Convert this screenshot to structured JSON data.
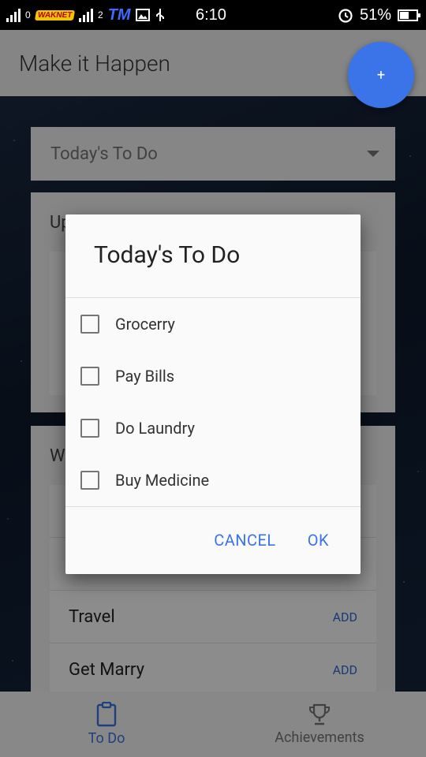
{
  "status_bar": {
    "carrier_logo": "WAKNET",
    "sim2_indicator": "2",
    "carrier_name": "TM",
    "time": "6:10",
    "battery": "51%",
    "icons": [
      "signal-icon",
      "image-icon",
      "usb-icon",
      "alarm-icon",
      "battery-icon"
    ]
  },
  "app_bar": {
    "title": "Make it Happen",
    "fab_label": "+"
  },
  "main": {
    "dropdown_value": "Today's To Do",
    "card2_title": "Up",
    "card3_title": "W",
    "goals": [
      {
        "name": "Travel",
        "action": "ADD"
      },
      {
        "name": "Get Marry",
        "action": "ADD"
      }
    ]
  },
  "bottom_nav": {
    "items": [
      {
        "label": "To Do",
        "icon": "clipboard-icon",
        "active": true
      },
      {
        "label": "Achievements",
        "icon": "trophy-icon",
        "active": false
      }
    ]
  },
  "dialog": {
    "title": "Today's To Do",
    "items": [
      {
        "label": "Grocerry",
        "checked": false
      },
      {
        "label": "Pay Bills",
        "checked": false
      },
      {
        "label": "Do Laundry",
        "checked": false
      },
      {
        "label": "Buy Medicine",
        "checked": false
      }
    ],
    "cancel_label": "CANCEL",
    "ok_label": "OK"
  },
  "colors": {
    "accent": "#3b74e8",
    "status_bar": "#000000"
  }
}
